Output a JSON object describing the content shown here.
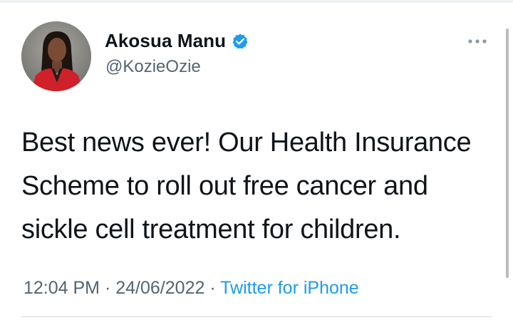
{
  "author": {
    "display_name": "Akosua Manu",
    "handle": "@KozieOzie",
    "verified": true,
    "avatar_icon": "profile-photo"
  },
  "tweet": {
    "text_lines": [
      "Best news ever!  Our Health Insurance",
      "Scheme to roll out free cancer and",
      "sickle cell treatment for children."
    ],
    "time": "12:04 PM",
    "date": "24/06/2022",
    "separator": "·",
    "source": "Twitter for iPhone"
  },
  "icons": {
    "verified": "verified-badge-icon",
    "more": "more-options-icon"
  },
  "colors": {
    "name": "#0f1419",
    "secondary": "#536471",
    "accent": "#1d9bf0"
  }
}
